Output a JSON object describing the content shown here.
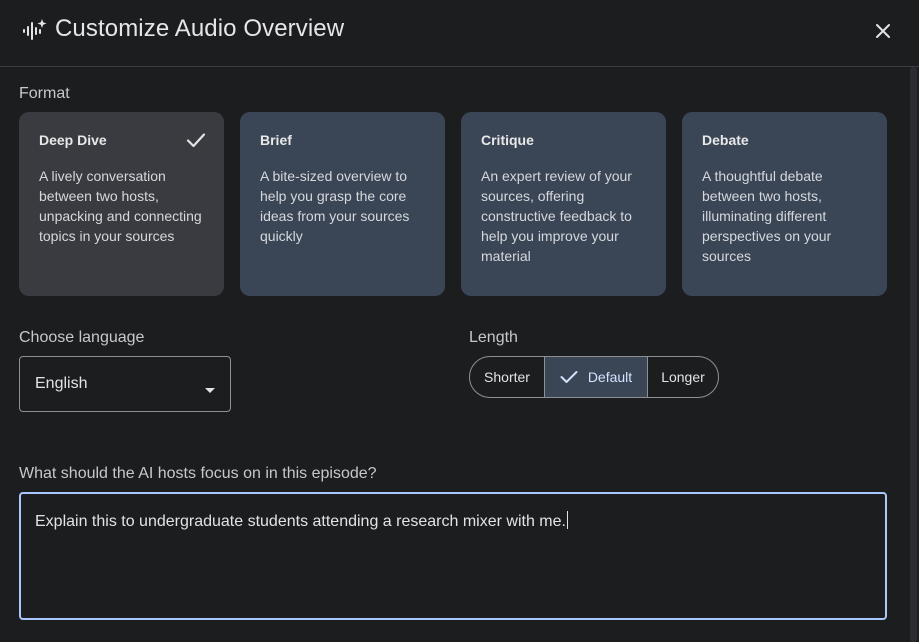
{
  "header": {
    "title": "Customize Audio Overview",
    "logo_icon": "audio-sparkle-icon",
    "close_icon": "close-icon"
  },
  "format": {
    "label": "Format",
    "selected": "Deep Dive",
    "cards": [
      {
        "title": "Deep Dive",
        "desc": "A lively conversation between two hosts, unpacking and connecting topics in your sources",
        "selected": true
      },
      {
        "title": "Brief",
        "desc": "A bite-sized overview to help you grasp the core ideas from your sources quickly",
        "selected": false
      },
      {
        "title": "Critique",
        "desc": "An expert review of your sources, offering constructive feedback to help you improve your material",
        "selected": false
      },
      {
        "title": "Debate",
        "desc": "A thoughtful debate between two hosts, illuminating different perspectives on your sources",
        "selected": false
      }
    ]
  },
  "language": {
    "label": "Choose language",
    "value": "English"
  },
  "length": {
    "label": "Length",
    "options": [
      "Shorter",
      "Default",
      "Longer"
    ],
    "selected": "Default"
  },
  "focus": {
    "label": "What should the AI hosts focus on in this episode?",
    "value": "Explain this to undergraduate students attending a research mixer with me."
  },
  "colors": {
    "background": "#1c1d1f",
    "card": "#3a4556",
    "card_selected": "#393b40",
    "focus_border": "#a8c7fa"
  }
}
